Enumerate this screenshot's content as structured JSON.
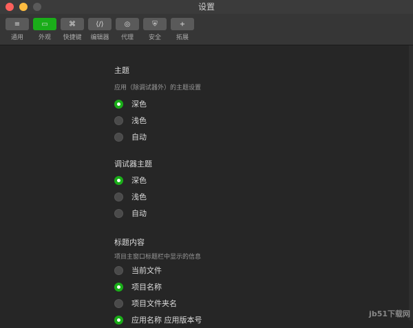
{
  "window": {
    "title": "设置"
  },
  "toolbar": [
    {
      "label": "通用",
      "icon": "≡"
    },
    {
      "label": "外观",
      "icon": "▭"
    },
    {
      "label": "快捷键",
      "icon": "⌘"
    },
    {
      "label": "编辑器",
      "icon": "⟨/⟩"
    },
    {
      "label": "代理",
      "icon": "◎"
    },
    {
      "label": "安全",
      "icon": "⛨"
    },
    {
      "label": "拓展",
      "icon": "+"
    }
  ],
  "sections": [
    {
      "title": "主题",
      "subtitle": "应用（除调试器外）的主题设置",
      "options": [
        "深色",
        "浅色",
        "自动"
      ],
      "selected": 0
    },
    {
      "title": "调试器主题",
      "options": [
        "深色",
        "浅色",
        "自动"
      ],
      "selected": 0
    },
    {
      "title": "标题内容",
      "subtitle": "项目主窗口标题栏中显示的信息",
      "options": [
        "当前文件",
        "项目名称",
        "项目文件夹名",
        "应用名称 应用版本号"
      ],
      "selected": [
        1,
        3
      ]
    }
  ],
  "watermark": "jb51下载网",
  "colors": {
    "accent": "#1aad19"
  }
}
